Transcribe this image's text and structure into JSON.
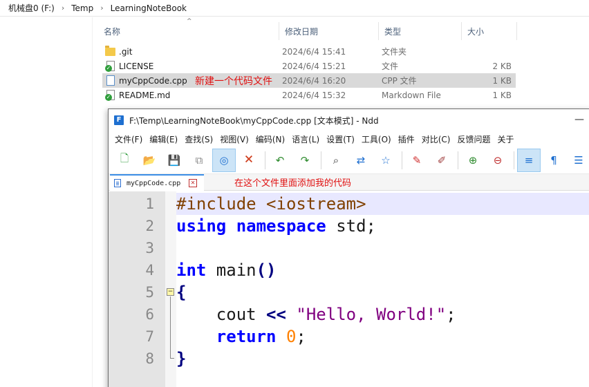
{
  "explorer": {
    "breadcrumb": [
      "机械盘0 (F:)",
      "Temp",
      "LearningNoteBook"
    ],
    "columns": {
      "name": "名称",
      "date": "修改日期",
      "type": "类型",
      "size": "大小"
    },
    "files": [
      {
        "name": ".git",
        "date": "2024/6/4 15:41",
        "type": "文件夹",
        "size": "",
        "icon": "folder-icon"
      },
      {
        "name": "LICENSE",
        "date": "2024/6/4 15:21",
        "type": "文件",
        "size": "2 KB",
        "icon": "git-synced-file-icon"
      },
      {
        "name": "myCppCode.cpp",
        "date": "2024/6/4 16:20",
        "type": "CPP 文件",
        "size": "1 KB",
        "icon": "cpp-file-icon",
        "selected": true
      },
      {
        "name": "README.md",
        "date": "2024/6/4 15:32",
        "type": "Markdown File",
        "size": "1 KB",
        "icon": "git-synced-file-icon"
      }
    ],
    "annotation": "新建一个代码文件"
  },
  "ndd": {
    "title": "F:\\Temp\\LearningNoteBook\\myCppCode.cpp [文本模式] - Ndd",
    "minimize": "—",
    "menu": [
      "文件(F)",
      "编辑(E)",
      "查找(S)",
      "视图(V)",
      "编码(N)",
      "语言(L)",
      "设置(T)",
      "工具(O)",
      "插件",
      "对比(C)",
      "反馈问题",
      "关于"
    ],
    "tab": {
      "label": "myCppCode.cpp",
      "close": "✕"
    },
    "tab_annotation": "在这个文件里面添加我的代码",
    "line_numbers": [
      "1",
      "2",
      "3",
      "4",
      "5",
      "6",
      "7",
      "8"
    ],
    "code": {
      "l1": "#include <iostream>",
      "l2_kw1": "using",
      "l2_kw2": "namespace",
      "l2_rest": " std;",
      "l4_kw": "int",
      "l4_name": " main",
      "l4_paren": "()",
      "l5": "{",
      "l6_indent": "    cout ",
      "l6_op": "<<",
      "l6_str": "\"Hello, World!\"",
      "l6_end": ";",
      "l7_indent": "    ",
      "l7_kw": "return",
      "l7_num": "0",
      "l7_end": ";",
      "l8": "}"
    },
    "fold_toggle": "−"
  },
  "colors": {
    "accent": "#3b8ee6",
    "annotation": "#e01010",
    "keyword": "#0000ff",
    "string": "#800080",
    "number": "#ff8000"
  }
}
